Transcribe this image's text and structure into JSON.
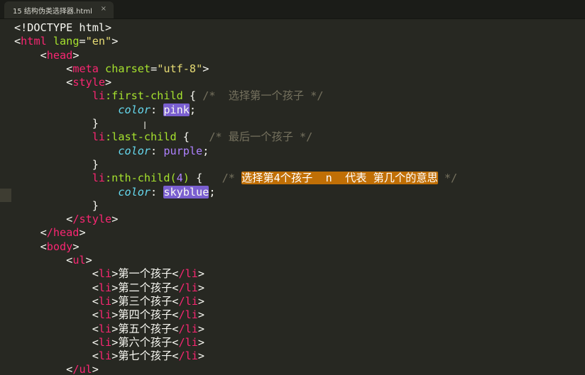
{
  "tab": {
    "title": "15 结构伪类选择器.html",
    "close_glyph": "×"
  },
  "code": {
    "l1": "<!DOCTYPE html>",
    "l2_open": "<",
    "l2_tag": "html",
    "l2_attr": "lang",
    "l2_eq": "=",
    "l2_str": "\"en\"",
    "l2_close": ">",
    "l3_tag": "head",
    "l4_tag": "meta",
    "l4_attr": "charset",
    "l4_str": "\"utf-8\"",
    "l5_tag": "style",
    "l6_sel": "li",
    "l6_pseudo": ":first-child",
    "l6_brace": " { ",
    "l6_comment": "/*  选择第一个孩子 */",
    "l7_prop": "color",
    "l7_val": "pink",
    "l8": "}",
    "l9_sel": "li",
    "l9_pseudo": ":last-child",
    "l9_brace": " {   ",
    "l9_comment": "/* 最后一个孩子 */",
    "l10_prop": "color",
    "l10_val": "purple",
    "l11": "}",
    "l12_sel": "li",
    "l12_pseudo": ":nth-child(",
    "l12_num": "4",
    "l12_pseudo_end": ")",
    "l12_brace": " {   ",
    "l12_comment_open": "/* ",
    "l12_comment_hl": "选择第4个孩子  n  代表 第几个的意思",
    "l12_comment_close": " */",
    "l13_prop": "color",
    "l13_val": "skyblue",
    "l14": "}",
    "l15_tag": "/style",
    "l16_tag": "/head",
    "l17_tag": "body",
    "l18_tag": "ul",
    "li_tag": "li",
    "li_close_tag": "/li",
    "items": [
      "第一个孩子",
      "第二个孩子",
      "第三个孩子",
      "第四个孩子",
      "第五个孩子",
      "第六个孩子",
      "第七个孩子"
    ],
    "l26_tag": "/ul"
  },
  "colors": {
    "background": "#272822",
    "tag": "#f92672",
    "attribute": "#a6e22e",
    "string": "#e6db74",
    "property": "#66d9ef",
    "value": "#ae81ff",
    "comment": "#75715e",
    "selection": "#7a5fd0",
    "find_highlight": "#c06f06"
  },
  "icons": {
    "mouse_cursor": "text-cursor-icon"
  }
}
